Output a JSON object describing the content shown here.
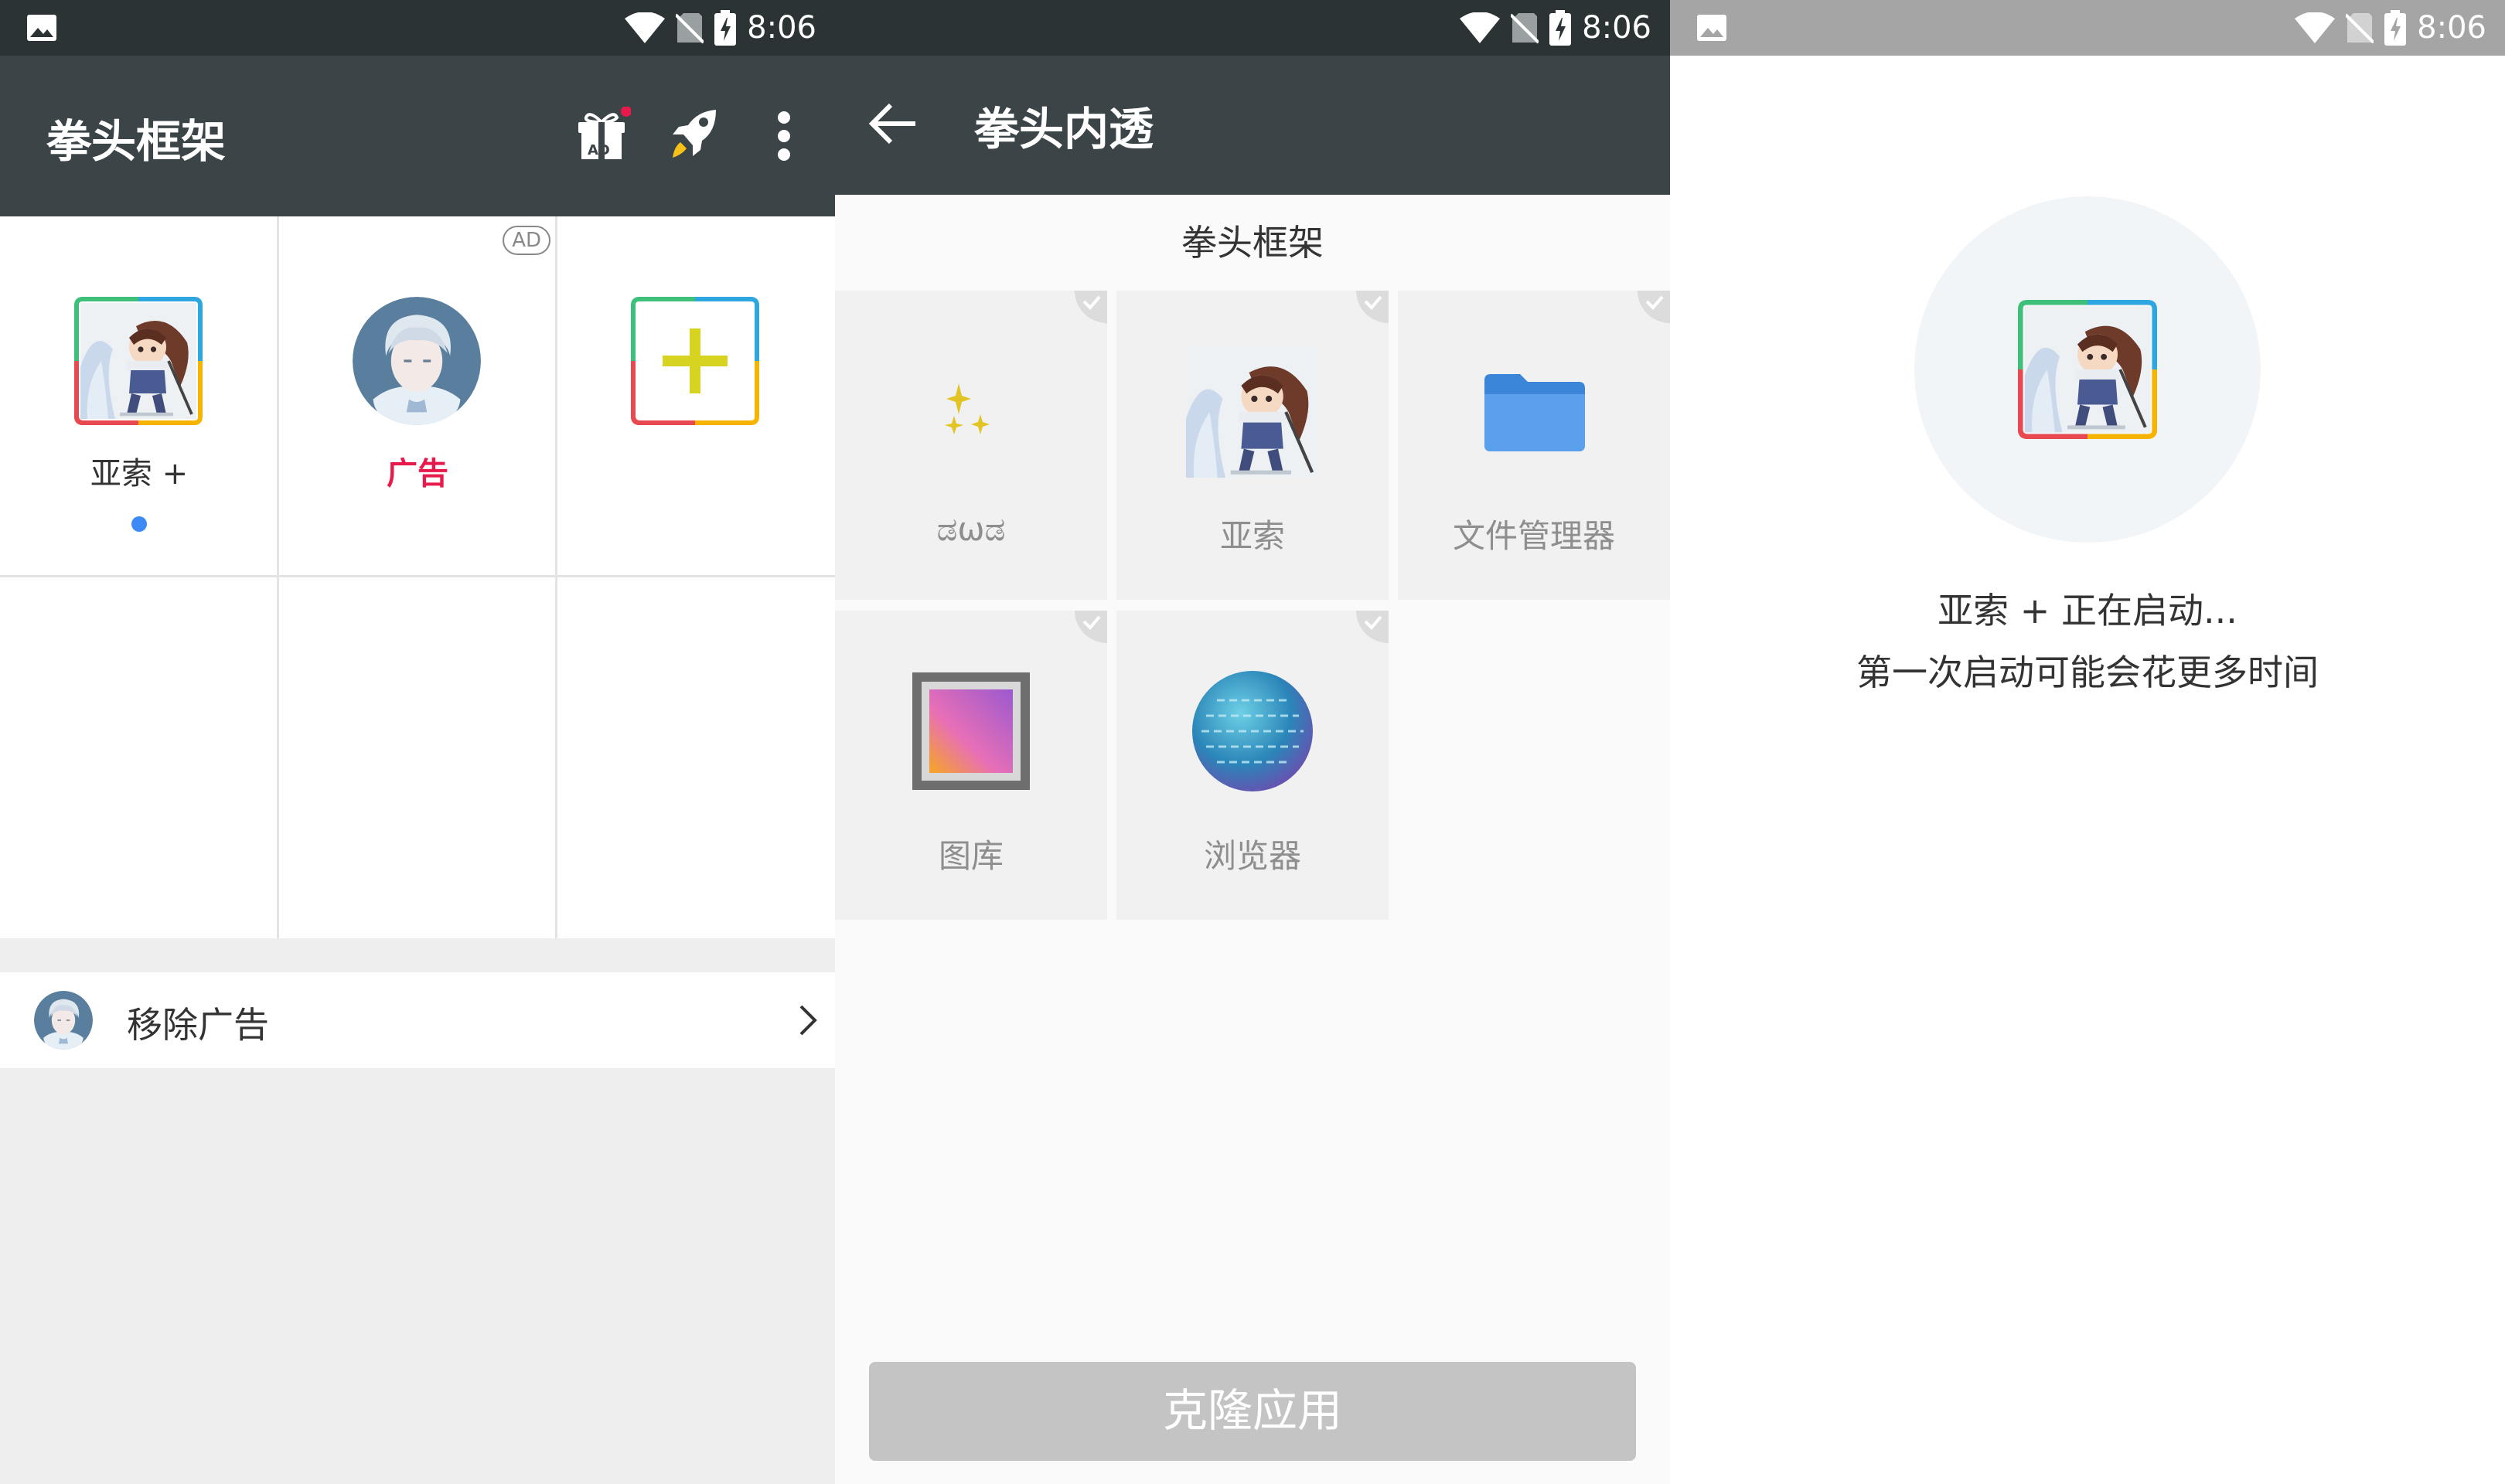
{
  "status_bar": {
    "time": "8:06"
  },
  "main": {
    "title": "拳头框架",
    "toolbar": {
      "gift_badge": "AD"
    },
    "apps": [
      {
        "label": "亚索 +"
      },
      {
        "label": "广告",
        "badge": "AD"
      },
      {
        "label": ""
      }
    ],
    "remove_ads": {
      "label": "移除广告"
    }
  },
  "clone": {
    "title": "拳头内透",
    "section": "拳头框架",
    "apps": [
      {
        "label": "ಡωಡ"
      },
      {
        "label": "亚索"
      },
      {
        "label": "文件管理器"
      },
      {
        "label": "图库"
      },
      {
        "label": "浏览器"
      }
    ],
    "button": "克隆应用"
  },
  "launch": {
    "line1": "亚索 + 正在启动...",
    "line2": "第一次启动可能会花更多时间"
  },
  "colors": {
    "appbar": "#3b4446",
    "statusbar": "#2b3335",
    "ad_red": "#e8194b",
    "accent_blue": "#3d8af7",
    "plus_yellow": "#d7d421"
  }
}
